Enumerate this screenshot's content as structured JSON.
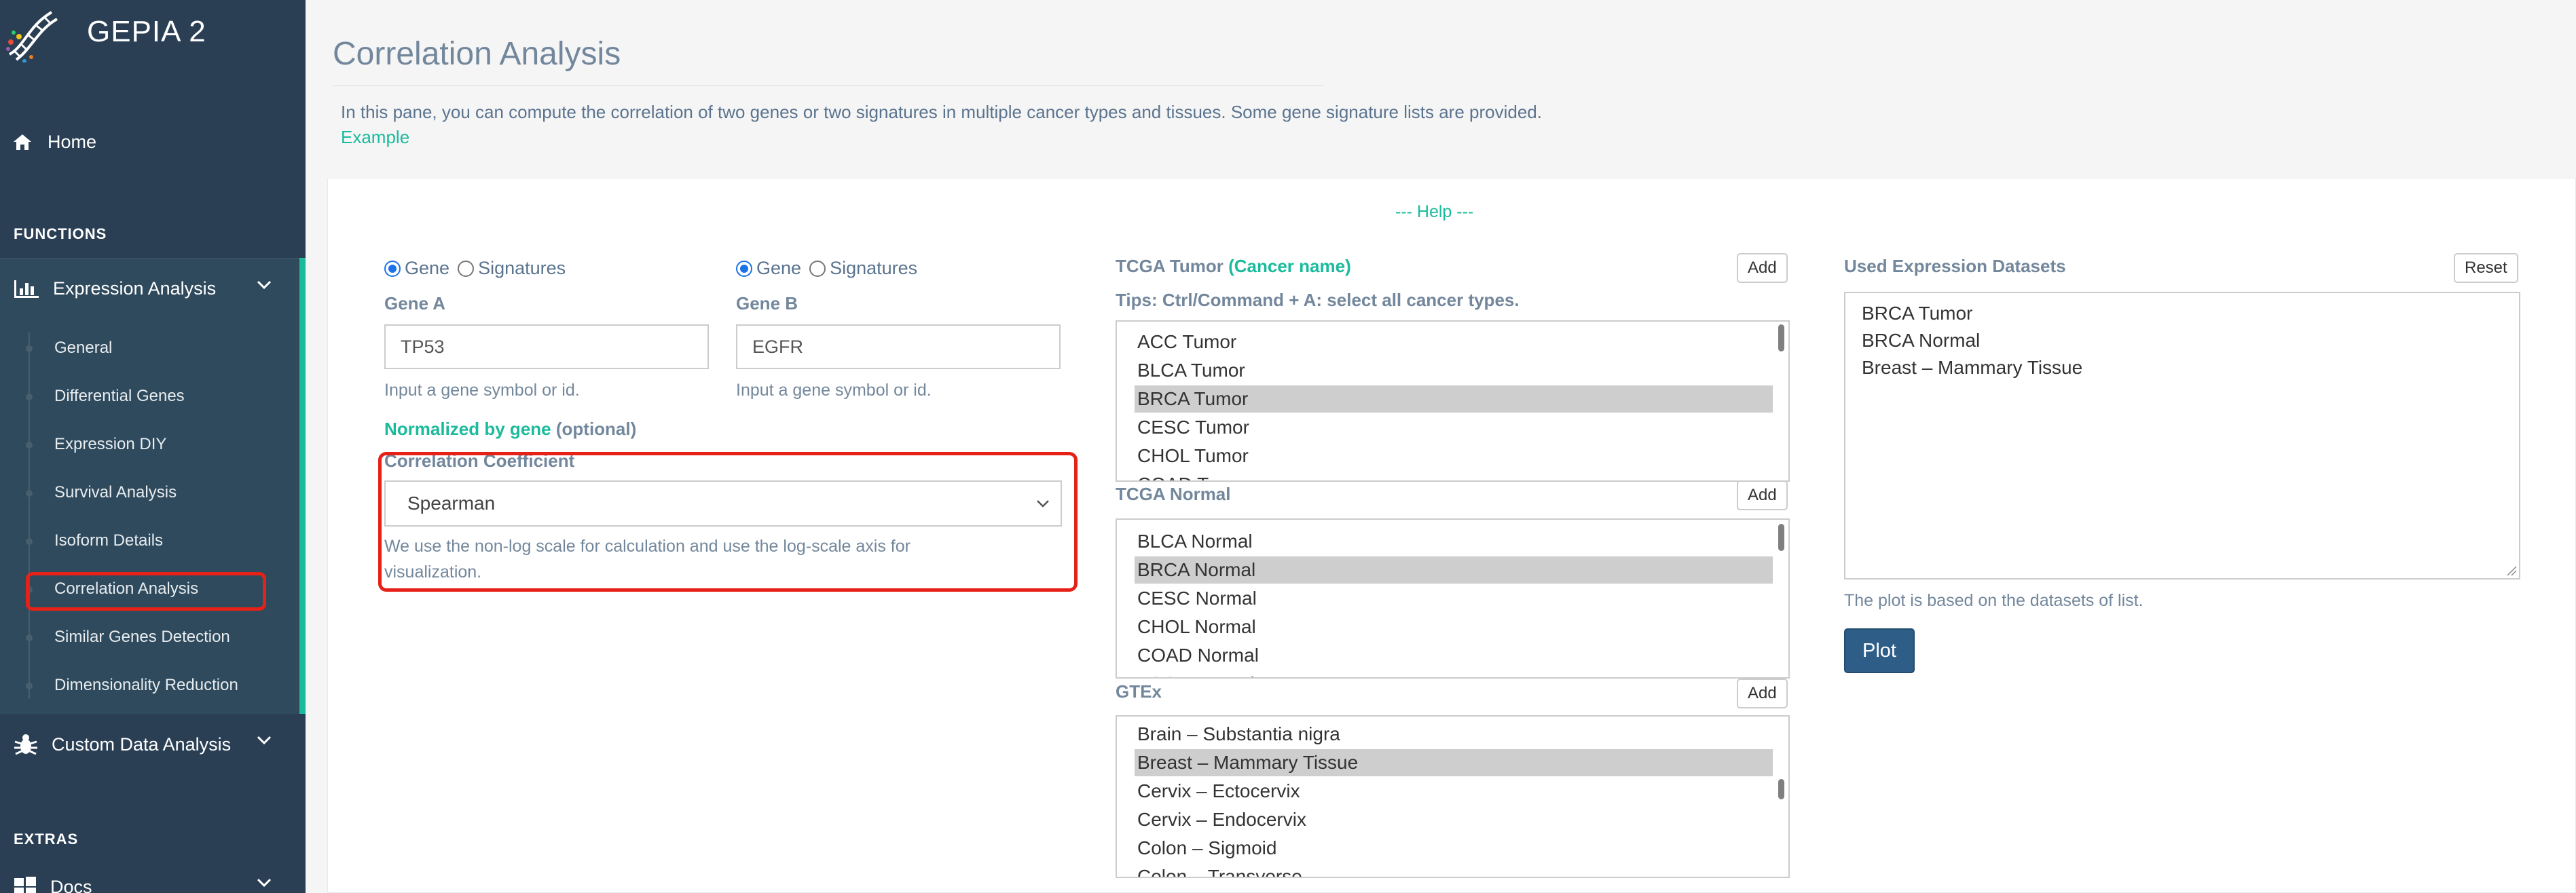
{
  "sidebar": {
    "brand": "GEPIA 2",
    "home_label": "Home",
    "functions_heading": "FUNCTIONS",
    "expression_analysis": "Expression Analysis",
    "sub_items": [
      "General",
      "Differential Genes",
      "Expression DIY",
      "Survival Analysis",
      "Isoform Details",
      "Correlation Analysis",
      "Similar Genes Detection",
      "Dimensionality Reduction"
    ],
    "active_item": "Correlation Analysis",
    "custom_data_analysis": "Custom Data Analysis",
    "extras_heading": "EXTRAS",
    "docs": "Docs"
  },
  "main": {
    "title": "Correlation Analysis",
    "intro": "In this pane, you can compute the correlation of two genes or two signatures in multiple cancer types and tissues. Some gene signature lists are provided.",
    "example_link": "Example",
    "help_link": "--- Help ---"
  },
  "form": {
    "radio_gene": "Gene",
    "radio_signatures": "Signatures",
    "gene_a_label": "Gene A",
    "gene_a_value": "TP53",
    "gene_b_label": "Gene B",
    "gene_b_value": "EGFR",
    "input_hint": "Input a gene symbol or id.",
    "normalized_by": "Normalized by gene",
    "optional": "(optional)",
    "coef_label": "Correlation Coefficient",
    "coef_value": "Spearman",
    "coef_note_1": "We use the non-log scale for calculation and use the log-scale axis for",
    "coef_note_2": "visualization."
  },
  "datasets": {
    "tcga_tumor_title": "TCGA Tumor",
    "tcga_tumor_note": "(Cancer name)",
    "tips": "Tips: Ctrl/Command + A: select all cancer types.",
    "add_label": "Add",
    "tcga_tumor": [
      "ACC Tumor",
      "BLCA Tumor",
      "BRCA Tumor",
      "CESC Tumor",
      "CHOL Tumor",
      "COAD Tumor"
    ],
    "tcga_tumor_selected": "BRCA Tumor",
    "tcga_normal_title": "TCGA Normal",
    "tcga_normal": [
      "BLCA Normal",
      "BRCA Normal",
      "CESC Normal",
      "CHOL Normal",
      "COAD Normal",
      "ESCA Normal"
    ],
    "tcga_normal_selected": "BRCA Normal",
    "gtex_title": "GTEx",
    "gtex": [
      "Brain – Substantia nigra",
      "Breast – Mammary Tissue",
      "Cervix – Ectocervix",
      "Cervix – Endocervix",
      "Colon – Sigmoid",
      "Colon – Transverse"
    ],
    "gtex_selected": "Breast – Mammary Tissue",
    "used_title": "Used Expression Datasets",
    "reset_label": "Reset",
    "used": [
      "BRCA Tumor",
      "BRCA Normal",
      "Breast – Mammary Tissue"
    ],
    "plot_note": "The plot is based on the datasets of list.",
    "plot_label": "Plot"
  },
  "colors": {
    "sidebar_bg": "#2a3f54",
    "accent": "#1abb9c",
    "highlight_border": "#e62117",
    "plot_button": "#2e5e88"
  }
}
